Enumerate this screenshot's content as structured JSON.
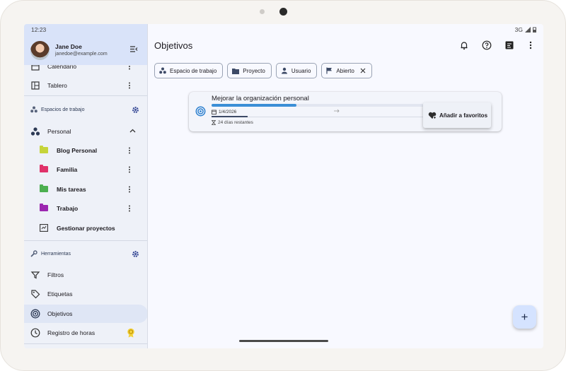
{
  "status": {
    "time": "12:23",
    "network": "3G"
  },
  "user": {
    "name": "Jane Doe",
    "email": "janedoe@example.com"
  },
  "drawer": {
    "top_items": [
      {
        "label": "Calendario",
        "icon": "calendar-icon"
      },
      {
        "label": "Tablero",
        "icon": "board-icon"
      }
    ],
    "workspaces_header": "Espacios de trabajo",
    "workspace": {
      "label": "Personal"
    },
    "projects": [
      {
        "label": "Blog Personal",
        "color": "#c6d43a"
      },
      {
        "label": "Familia",
        "color": "#e0326a"
      },
      {
        "label": "Mis tareas",
        "color": "#4caf50"
      },
      {
        "label": "Trabajo",
        "color": "#9c27b0"
      }
    ],
    "manage_projects": "Gestionar proyectos",
    "tools_header": "Herramientas",
    "tools": [
      {
        "label": "Filtros",
        "icon": "filter-icon"
      },
      {
        "label": "Etiquetas",
        "icon": "tag-icon"
      },
      {
        "label": "Objetivos",
        "icon": "target-icon",
        "active": true
      },
      {
        "label": "Registro de horas",
        "icon": "clock-icon"
      }
    ]
  },
  "main": {
    "title": "Objetivos",
    "chips": [
      {
        "label": "Espacio de trabajo",
        "icon": "workspace-icon"
      },
      {
        "label": "Proyecto",
        "icon": "folder-icon"
      },
      {
        "label": "Usuario",
        "icon": "person-icon"
      },
      {
        "label": "Abierto",
        "icon": "flag-icon"
      }
    ],
    "goal": {
      "title": "Mejorar la organización personal",
      "progress": 0.4,
      "date": "1/4/2026",
      "remaining": "24 días restantes",
      "time_progress": 0.17
    },
    "popup": {
      "label": "Añadir a favoritos"
    },
    "fab_label": "+"
  },
  "colors": {
    "accent": "#3b8ed6",
    "drawer_header": "#d9e3f9",
    "fab": "#d5e3ff"
  }
}
